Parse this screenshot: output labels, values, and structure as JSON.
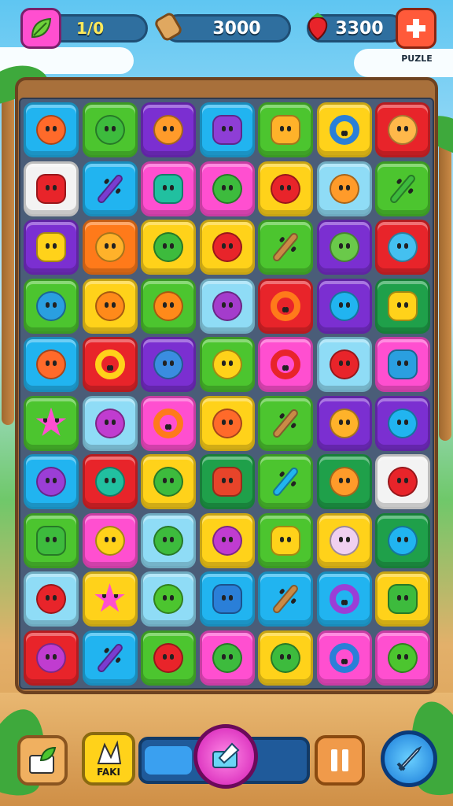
{
  "hud": {
    "moves": "1/0",
    "coins": "3000",
    "fruit": "3300",
    "plus_caption": "PUZLE"
  },
  "bottom": {
    "boost_label": "FAKI"
  },
  "colors": {
    "orange": "#ff7a1a",
    "green": "#4cc52f",
    "purple": "#7b2fd1",
    "cyan": "#21b4f0",
    "yellow": "#ffd21a",
    "red": "#e8242a",
    "pink": "#ff4fd0",
    "lightblue": "#8fdcf6",
    "white": "#f3f3f3",
    "darkgreen": "#1fa04a"
  },
  "grid": [
    [
      [
        "cyan",
        "blob",
        "#ff6a2a"
      ],
      [
        "green",
        "blob",
        "#3dbb3d"
      ],
      [
        "purple",
        "blob",
        "#ff9b2a"
      ],
      [
        "cyan",
        "gear",
        "#8e3ed6"
      ],
      [
        "green",
        "gear",
        "#ffb22a"
      ],
      [
        "yellow",
        "ring",
        "#2a7fd8"
      ],
      [
        "red",
        "blob",
        "#ffb84a"
      ]
    ],
    [
      [
        "white",
        "gear",
        "#e8242a"
      ],
      [
        "cyan",
        "stick",
        "#7a3cd0"
      ],
      [
        "pink",
        "gear",
        "#21c0a0"
      ],
      [
        "pink",
        "blob",
        "#3dbb3d"
      ],
      [
        "yellow",
        "blob",
        "#e8242a"
      ],
      [
        "lightblue",
        "blob",
        "#ff9b2a"
      ],
      [
        "green",
        "stick",
        "#3dbb3d"
      ]
    ],
    [
      [
        "purple",
        "gear",
        "#ffd21a"
      ],
      [
        "orange",
        "blob",
        "#ffb22a"
      ],
      [
        "yellow",
        "blob",
        "#3dbb3d"
      ],
      [
        "yellow",
        "blob",
        "#e8242a"
      ],
      [
        "green",
        "stick",
        "#c98a46"
      ],
      [
        "purple",
        "blob",
        "#6ac94a"
      ],
      [
        "red",
        "blob",
        "#44c0f0"
      ]
    ],
    [
      [
        "green",
        "blob",
        "#2a9fe0"
      ],
      [
        "yellow",
        "blob",
        "#ff8a1a"
      ],
      [
        "green",
        "blob",
        "#ff8a1a"
      ],
      [
        "lightblue",
        "blob",
        "#a43ccc"
      ],
      [
        "red",
        "ring",
        "#ff7a1a"
      ],
      [
        "purple",
        "blob",
        "#21b4f0"
      ],
      [
        "darkgreen",
        "gear",
        "#ffd21a"
      ]
    ],
    [
      [
        "cyan",
        "blob",
        "#ff6a2a"
      ],
      [
        "red",
        "ring",
        "#ffd21a"
      ],
      [
        "purple",
        "blob",
        "#3a8de0"
      ],
      [
        "green",
        "blob",
        "#ffd21a"
      ],
      [
        "pink",
        "ring",
        "#e8242a"
      ],
      [
        "lightblue",
        "blob",
        "#e8242a"
      ],
      [
        "pink",
        "gear",
        "#2a9fe0"
      ]
    ],
    [
      [
        "green",
        "star",
        "#ff4fd0"
      ],
      [
        "lightblue",
        "blob",
        "#c03cd0"
      ],
      [
        "pink",
        "ring",
        "#ff7a1a"
      ],
      [
        "yellow",
        "blob",
        "#ff6a2a"
      ],
      [
        "green",
        "stick",
        "#c98a46"
      ],
      [
        "purple",
        "blob",
        "#ffb22a"
      ],
      [
        "purple",
        "blob",
        "#21b4f0"
      ]
    ],
    [
      [
        "cyan",
        "blob",
        "#9b3ed6"
      ],
      [
        "red",
        "blob",
        "#21c0a0"
      ],
      [
        "yellow",
        "blob",
        "#3dbb3d"
      ],
      [
        "darkgreen",
        "gear",
        "#e8442a"
      ],
      [
        "green",
        "stick",
        "#21b4f0"
      ],
      [
        "darkgreen",
        "blob",
        "#ff9b2a"
      ],
      [
        "white",
        "blob",
        "#e8242a"
      ]
    ],
    [
      [
        "green",
        "gear",
        "#3dbb3d"
      ],
      [
        "pink",
        "blob",
        "#ffd21a"
      ],
      [
        "lightblue",
        "blob",
        "#3dbb3d"
      ],
      [
        "yellow",
        "blob",
        "#c03cd0"
      ],
      [
        "green",
        "gear",
        "#ffd21a"
      ],
      [
        "yellow",
        "blob",
        "#f0d0f0"
      ],
      [
        "darkgreen",
        "blob",
        "#21b4f0"
      ]
    ],
    [
      [
        "lightblue",
        "blob",
        "#e8242a"
      ],
      [
        "yellow",
        "star",
        "#ff4fd0"
      ],
      [
        "lightblue",
        "blob",
        "#4cc52f"
      ],
      [
        "cyan",
        "gear",
        "#2a7fd8"
      ],
      [
        "cyan",
        "stick",
        "#c98a46"
      ],
      [
        "cyan",
        "ring",
        "#9b3ed6"
      ],
      [
        "yellow",
        "gear",
        "#3dbb3d"
      ]
    ],
    [
      [
        "red",
        "blob",
        "#c03cd0"
      ],
      [
        "cyan",
        "stick",
        "#7a3cd0"
      ],
      [
        "green",
        "blob",
        "#e8242a"
      ],
      [
        "pink",
        "blob",
        "#3dbb3d"
      ],
      [
        "yellow",
        "blob",
        "#3dbb3d"
      ],
      [
        "pink",
        "ring",
        "#2a7fd8"
      ],
      [
        "pink",
        "blob",
        "#4cc52f"
      ]
    ]
  ]
}
